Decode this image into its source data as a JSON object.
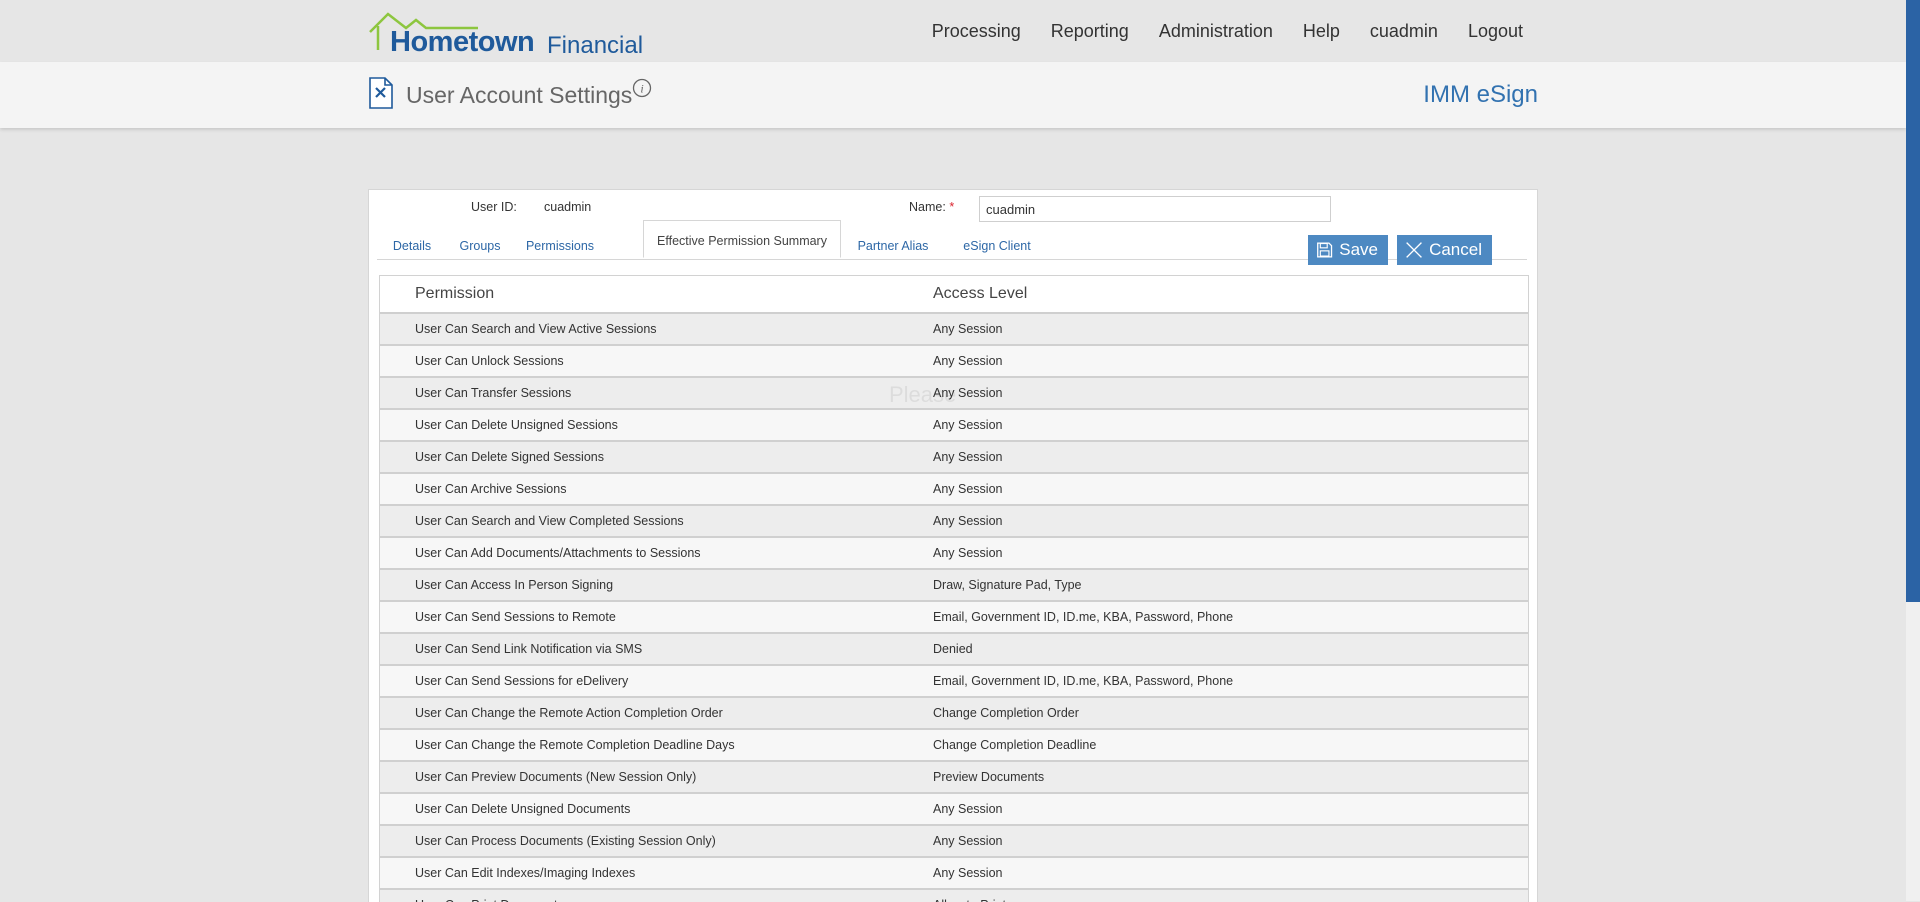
{
  "brand": {
    "name_bold": "Hometown",
    "name_light": "Financial",
    "color": "#1f5a9b",
    "roof_color": "#8dc63f"
  },
  "nav": [
    "Processing",
    "Reporting",
    "Administration",
    "Help",
    "cuadmin",
    "Logout"
  ],
  "page": {
    "title": "User Account Settings",
    "product": "IMM eSign",
    "icon": "settings-doc-icon",
    "info_icon": "info-icon"
  },
  "form": {
    "user_id_label": "User ID:",
    "user_id_value": "cuadmin",
    "name_label": "Name:",
    "required_mark": "*",
    "name_value": "cuadmin"
  },
  "tabs": [
    "Details",
    "Groups",
    "Permissions",
    "Effective Permission Summary",
    "Partner Alias",
    "eSign Client"
  ],
  "active_tab": "Effective Permission Summary",
  "buttons": {
    "save": "Save",
    "cancel": "Cancel",
    "save_icon": "floppy-disk-icon",
    "cancel_icon": "close-icon"
  },
  "overlay_text": "Please",
  "table": {
    "headers": [
      "Permission",
      "Access Level"
    ],
    "rows": [
      [
        "User Can Search and View Active Sessions",
        "Any Session"
      ],
      [
        "User Can Unlock Sessions",
        "Any Session"
      ],
      [
        "User Can Transfer Sessions",
        "Any Session"
      ],
      [
        "User Can Delete Unsigned Sessions",
        "Any Session"
      ],
      [
        "User Can Delete Signed Sessions",
        "Any Session"
      ],
      [
        "User Can Archive Sessions",
        "Any Session"
      ],
      [
        "User Can Search and View Completed Sessions",
        "Any Session"
      ],
      [
        "User Can Add Documents/Attachments to Sessions",
        "Any Session"
      ],
      [
        "User Can Access In Person Signing",
        "Draw, Signature Pad, Type"
      ],
      [
        "User Can Send Sessions to Remote",
        "Email, Government ID, ID.me, KBA, Password, Phone"
      ],
      [
        "User Can Send Link Notification via SMS",
        "Denied"
      ],
      [
        "User Can Send Sessions for eDelivery",
        "Email, Government ID, ID.me, KBA, Password, Phone"
      ],
      [
        "User Can Change the Remote Action Completion Order",
        "Change Completion Order"
      ],
      [
        "User Can Change the Remote Completion Deadline Days",
        "Change Completion Deadline"
      ],
      [
        "User Can Preview Documents (New Session Only)",
        "Preview Documents"
      ],
      [
        "User Can Delete Unsigned Documents",
        "Any Session"
      ],
      [
        "User Can Process Documents (Existing Session Only)",
        "Any Session"
      ],
      [
        "User Can Edit Indexes/Imaging Indexes",
        "Any Session"
      ],
      [
        "User Can Print Documents",
        "Allow to Print"
      ]
    ]
  }
}
